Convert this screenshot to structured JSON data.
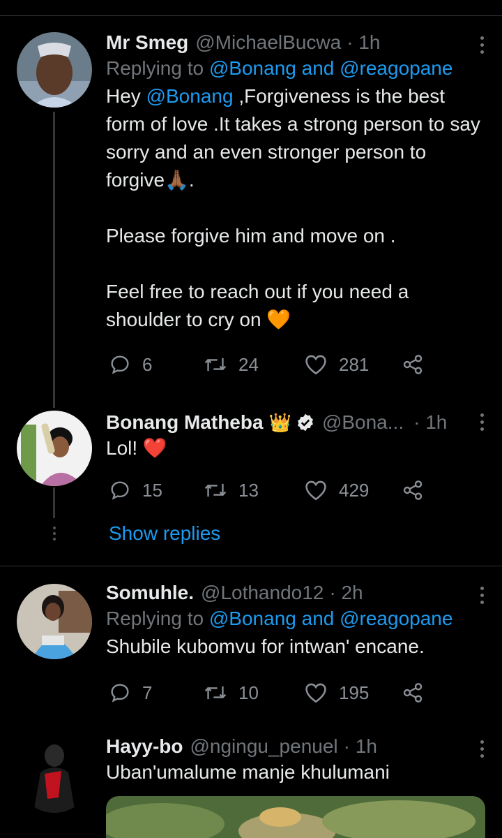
{
  "tweets": [
    {
      "name": "Mr Smeg",
      "handle": "@MichaelBucwa",
      "time": "· 1h",
      "reply_prefix": "Replying to ",
      "reply_to": "@Bonang and @reagopane",
      "body_prefix": "Hey ",
      "body_mention": "@Bonang",
      "body_text": " ,Forgiveness is the best form of love .It takes a strong person to say sorry and an even stronger person to forgive🙏🏾.\n\nPlease forgive him and move on .\n\nFeel free to reach out if you need a shoulder to cry on 🧡",
      "replies": "6",
      "retweets": "24",
      "likes": "281"
    },
    {
      "name": "Bonang Matheba",
      "badge_emoji": "👑",
      "handle": "@Bona...",
      "time": "· 1h",
      "body_text": "Lol! ❤️",
      "replies": "15",
      "retweets": "13",
      "likes": "429"
    },
    {
      "name": "Somuhle.",
      "handle": "@Lothando12",
      "time": "· 2h",
      "reply_prefix": "Replying to ",
      "reply_to": "@Bonang and @reagopane",
      "body_text": "Shubile kubomvu for intwan' encane.",
      "replies": "7",
      "retweets": "10",
      "likes": "195"
    },
    {
      "name": "Hayy-bo",
      "handle": "@ngingu_penuel",
      "time": "· 1h",
      "body_text": "Uban'umalume manje khulumani"
    }
  ],
  "show_replies": "Show replies",
  "colors": {
    "accent": "#1d9bf0",
    "muted": "#71767b",
    "background": "#000000"
  }
}
